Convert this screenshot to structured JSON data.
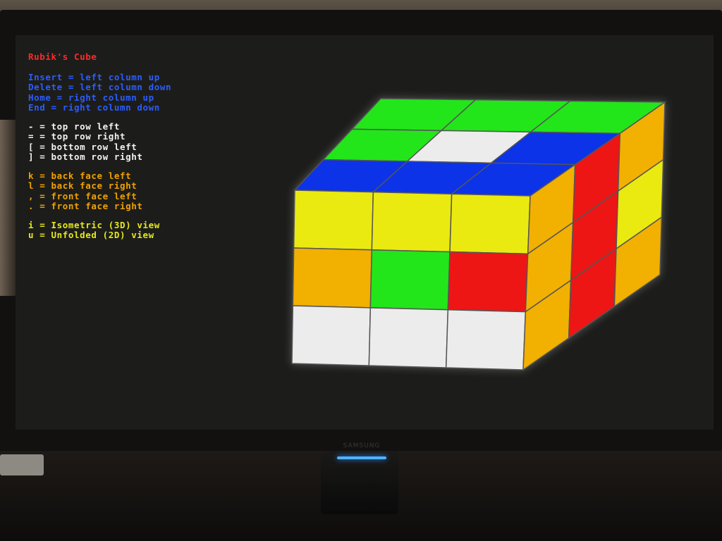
{
  "app": {
    "title": "Rubik's Cube"
  },
  "legend": {
    "groups": [
      {
        "color": "#2c5cff",
        "lines": [
          "Insert = left column up",
          "Delete = left column down",
          "Home = right column up",
          "End = right column down"
        ]
      },
      {
        "color": "#f2f2f2",
        "lines": [
          "- = top row left",
          "= = top row right",
          "[ = bottom row left",
          "] = bottom row right"
        ]
      },
      {
        "color": "#f2a100",
        "lines": [
          "k = back face left",
          "l = back face right",
          ", = front face left",
          ". = front face right"
        ]
      },
      {
        "color": "#e6e81e",
        "lines": [
          "i = Isometric (3D) view",
          "u = Unfolded (2D) view"
        ]
      }
    ]
  },
  "cube": {
    "colors": {
      "G": "#22e61a",
      "W": "#ececec",
      "B": "#0c33e8",
      "Y": "#eaea10",
      "O": "#f2b000",
      "R": "#ee1515"
    },
    "faces": {
      "top": [
        [
          "G",
          "G",
          "G"
        ],
        [
          "G",
          "W",
          "B"
        ],
        [
          "B",
          "B",
          "B"
        ]
      ],
      "front": [
        [
          "Y",
          "Y",
          "Y"
        ],
        [
          "O",
          "G",
          "R"
        ],
        [
          "W",
          "W",
          "W"
        ]
      ],
      "right": [
        [
          "O",
          "R",
          "O"
        ],
        [
          "O",
          "R",
          "Y"
        ],
        [
          "O",
          "R",
          "O"
        ]
      ]
    }
  },
  "monitor": {
    "brand": "SAMSUNG"
  }
}
